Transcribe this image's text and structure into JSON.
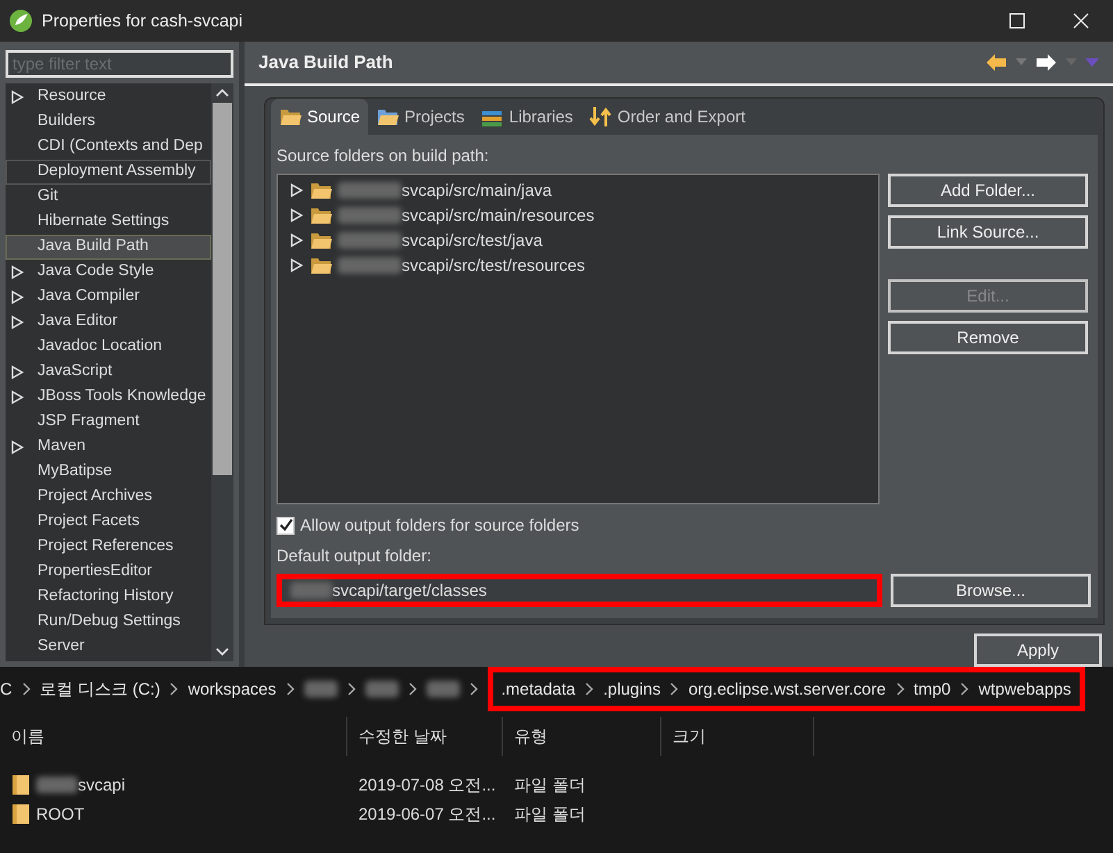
{
  "window": {
    "title": "Properties for cash-svcapi"
  },
  "filter": {
    "placeholder": "type filter text"
  },
  "sidebar": {
    "items": [
      {
        "label": "Resource",
        "expandable": true,
        "selected": false,
        "focused": false
      },
      {
        "label": "Builders",
        "expandable": false,
        "selected": false,
        "focused": false
      },
      {
        "label": "CDI (Contexts and Dep",
        "expandable": false,
        "selected": false,
        "focused": false
      },
      {
        "label": "Deployment Assembly",
        "expandable": false,
        "selected": false,
        "focused": true
      },
      {
        "label": "Git",
        "expandable": false,
        "selected": false,
        "focused": false
      },
      {
        "label": "Hibernate Settings",
        "expandable": false,
        "selected": false,
        "focused": false
      },
      {
        "label": "Java Build Path",
        "expandable": false,
        "selected": true,
        "focused": false
      },
      {
        "label": "Java Code Style",
        "expandable": true,
        "selected": false,
        "focused": false
      },
      {
        "label": "Java Compiler",
        "expandable": true,
        "selected": false,
        "focused": false
      },
      {
        "label": "Java Editor",
        "expandable": true,
        "selected": false,
        "focused": false
      },
      {
        "label": "Javadoc Location",
        "expandable": false,
        "selected": false,
        "focused": false
      },
      {
        "label": "JavaScript",
        "expandable": true,
        "selected": false,
        "focused": false
      },
      {
        "label": "JBoss Tools Knowledge",
        "expandable": true,
        "selected": false,
        "focused": false
      },
      {
        "label": "JSP Fragment",
        "expandable": false,
        "selected": false,
        "focused": false
      },
      {
        "label": "Maven",
        "expandable": true,
        "selected": false,
        "focused": false
      },
      {
        "label": "MyBatipse",
        "expandable": false,
        "selected": false,
        "focused": false
      },
      {
        "label": "Project Archives",
        "expandable": false,
        "selected": false,
        "focused": false
      },
      {
        "label": "Project Facets",
        "expandable": false,
        "selected": false,
        "focused": false
      },
      {
        "label": "Project References",
        "expandable": false,
        "selected": false,
        "focused": false
      },
      {
        "label": "PropertiesEditor",
        "expandable": false,
        "selected": false,
        "focused": false
      },
      {
        "label": "Refactoring History",
        "expandable": false,
        "selected": false,
        "focused": false
      },
      {
        "label": "Run/Debug Settings",
        "expandable": false,
        "selected": false,
        "focused": false
      },
      {
        "label": "Server",
        "expandable": false,
        "selected": false,
        "focused": false
      }
    ]
  },
  "page": {
    "title": "Java Build Path"
  },
  "tabs": [
    {
      "label": "Source",
      "kind": "source",
      "selected": true
    },
    {
      "label": "Projects",
      "kind": "projects",
      "selected": false
    },
    {
      "label": "Libraries",
      "kind": "libraries",
      "selected": false
    },
    {
      "label": "Order and Export",
      "kind": "order",
      "selected": false
    }
  ],
  "source_section": {
    "label": "Source folders on build path:",
    "folders": [
      {
        "redacted_prefix": true,
        "text": "svcapi/src/main/java"
      },
      {
        "redacted_prefix": true,
        "text": "svcapi/src/main/resources"
      },
      {
        "redacted_prefix": true,
        "text": "svcapi/src/test/java"
      },
      {
        "redacted_prefix": true,
        "text": "svcapi/src/test/resources"
      }
    ]
  },
  "buttons": [
    {
      "label": "Add Folder...",
      "disabled": false
    },
    {
      "label": "Link Source...",
      "disabled": false
    },
    {
      "label": "Edit...",
      "disabled": true
    },
    {
      "label": "Remove",
      "disabled": false
    }
  ],
  "allow_output": {
    "label": "Allow output folders for source folders",
    "checked": true
  },
  "output": {
    "label": "Default output folder:",
    "redacted_prefix": true,
    "value": "svcapi/target/classes",
    "highlighted": true
  },
  "browse_button": "Browse...",
  "apply_button": "Apply",
  "explorer": {
    "breadcrumb": [
      {
        "kind": "text",
        "label": "C"
      },
      {
        "kind": "text",
        "label": "로컬 디스크 (C:)"
      },
      {
        "kind": "text",
        "label": "workspaces"
      },
      {
        "kind": "redacted"
      },
      {
        "kind": "redacted"
      },
      {
        "kind": "redacted"
      }
    ],
    "highlighted_breadcrumb": [
      {
        "kind": "text",
        "label": ".metadata"
      },
      {
        "kind": "text",
        "label": ".plugins"
      },
      {
        "kind": "text",
        "label": "org.eclipse.wst.server.core"
      },
      {
        "kind": "text",
        "label": "tmp0"
      },
      {
        "kind": "text",
        "label": "wtpwebapps"
      }
    ],
    "columns": [
      "이름",
      "수정한 날짜",
      "유형",
      "크기"
    ],
    "rows": [
      {
        "redacted_prefix": true,
        "name": "svcapi",
        "modified": "2019-07-08 오전...",
        "type": "파일 폴더"
      },
      {
        "redacted_prefix": false,
        "name": "ROOT",
        "modified": "2019-06-07 오전...",
        "type": "파일 폴더"
      }
    ]
  }
}
